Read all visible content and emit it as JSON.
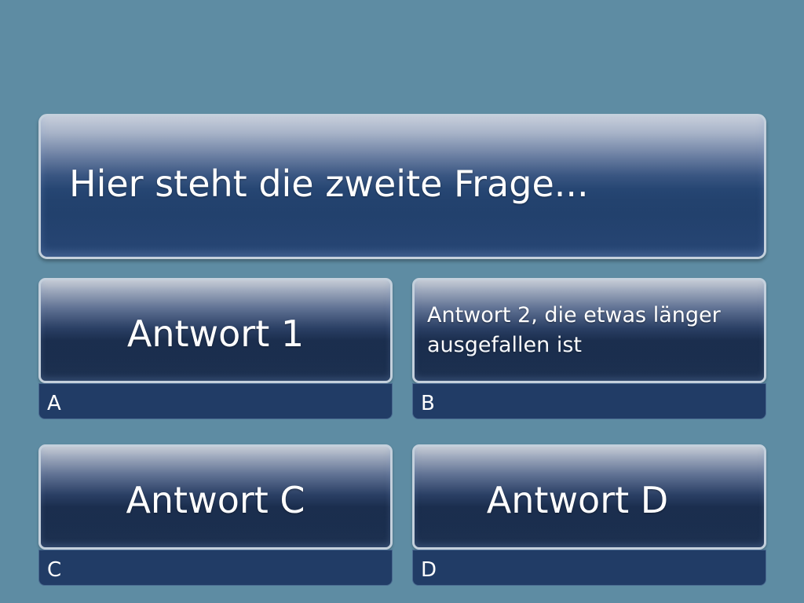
{
  "question": {
    "text": "Hier steht die zweite Frage..."
  },
  "answers": [
    {
      "text": "Antwort 1",
      "letter": "A"
    },
    {
      "text": "Antwort 2, die etwas länger ausgefallen ist",
      "letter": "B"
    },
    {
      "text": "Antwort C",
      "letter": "C"
    },
    {
      "text": "Antwort D",
      "letter": "D"
    }
  ],
  "colors": {
    "background": "#5e8ca3",
    "button_dark": "#132440",
    "letter_bar": "#213c66",
    "text": "#ffffff"
  }
}
